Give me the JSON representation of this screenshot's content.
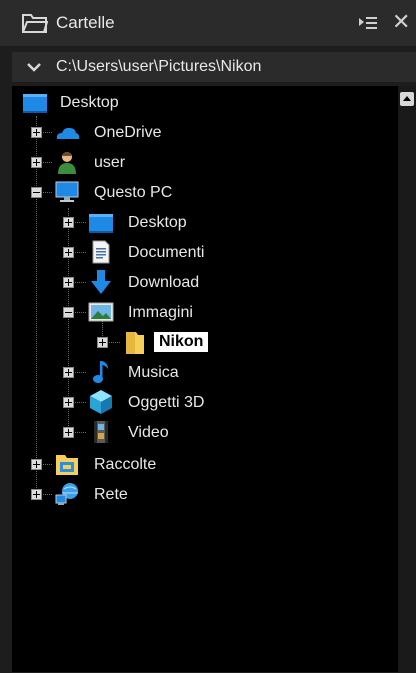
{
  "panel": {
    "title": "Cartelle",
    "close_glyph": "✕"
  },
  "pathbar": {
    "path": "C:\\Users\\user\\Pictures\\Nikon"
  },
  "tree": {
    "nodes": [
      {
        "label": "Desktop",
        "icon": "desktop-icon",
        "expander": "none"
      },
      {
        "label": "OneDrive",
        "icon": "onedrive-icon",
        "expander": "plus"
      },
      {
        "label": "user",
        "icon": "user-icon",
        "expander": "plus"
      },
      {
        "label": "Questo PC",
        "icon": "computer-icon",
        "expander": "minus"
      },
      {
        "label": "Desktop",
        "icon": "desktop-icon",
        "expander": "plus"
      },
      {
        "label": "Documenti",
        "icon": "documents-icon",
        "expander": "plus"
      },
      {
        "label": "Download",
        "icon": "download-icon",
        "expander": "plus"
      },
      {
        "label": "Immagini",
        "icon": "pictures-icon",
        "expander": "minus"
      },
      {
        "label": "Nikon",
        "icon": "folder-icon",
        "expander": "plus",
        "selected": true
      },
      {
        "label": "Musica",
        "icon": "music-icon",
        "expander": "plus"
      },
      {
        "label": "Oggetti 3D",
        "icon": "3d-objects-icon",
        "expander": "plus"
      },
      {
        "label": "Video",
        "icon": "video-icon",
        "expander": "plus"
      },
      {
        "label": "Raccolte",
        "icon": "libraries-icon",
        "expander": "plus"
      },
      {
        "label": "Rete",
        "icon": "network-icon",
        "expander": "plus"
      }
    ]
  },
  "colors": {
    "background": "#000000",
    "chrome": "#2b2b2b",
    "text": "#e8e8e8",
    "selected_bg": "#ffffff",
    "accent_blue": "#1e8ae6",
    "folder_yellow": "#f5cf5a"
  }
}
